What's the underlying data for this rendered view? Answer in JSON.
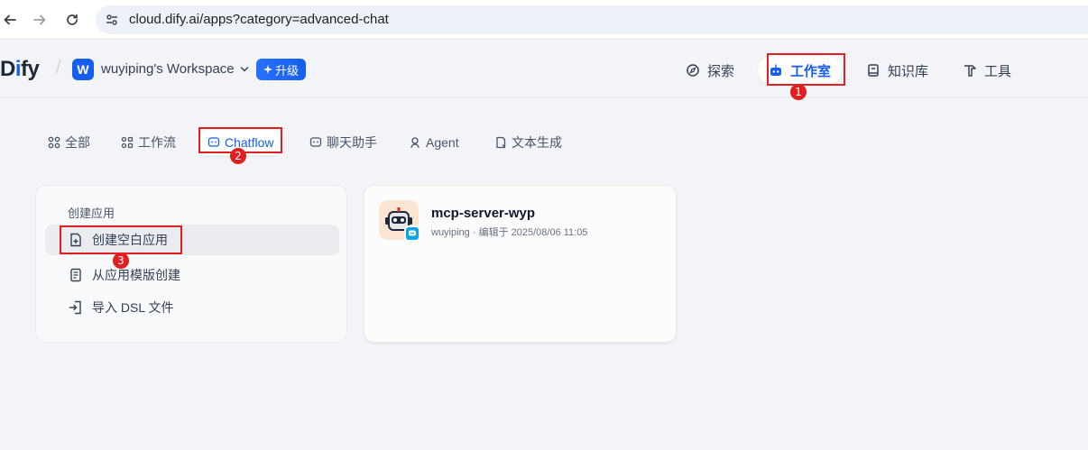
{
  "browser": {
    "url": "cloud.dify.ai/apps?category=advanced-chat"
  },
  "header": {
    "logo_prefix": "D",
    "logo_i": "i",
    "logo_suffix": "fy",
    "workspace_initial": "W",
    "workspace_name": "wuyiping's Workspace",
    "upgrade_label": "升级",
    "nav": [
      {
        "label": "探索",
        "icon": "compass-icon"
      },
      {
        "label": "工作室",
        "icon": "robot-icon"
      },
      {
        "label": "知识库",
        "icon": "book-icon"
      },
      {
        "label": "工具",
        "icon": "hammer-icon"
      }
    ]
  },
  "categories": [
    {
      "label": "全部",
      "icon": "grid-icon"
    },
    {
      "label": "工作流",
      "icon": "workflow-icon"
    },
    {
      "label": "Chatflow",
      "icon": "chat-bubble-icon"
    },
    {
      "label": "聊天助手",
      "icon": "chat-bot-icon"
    },
    {
      "label": "Agent",
      "icon": "agent-icon"
    },
    {
      "label": "文本生成",
      "icon": "file-text-icon"
    }
  ],
  "create": {
    "title": "创建应用",
    "items": [
      {
        "label": "创建空白应用",
        "icon": "file-plus-icon"
      },
      {
        "label": "从应用模版创建",
        "icon": "template-icon"
      },
      {
        "label": "导入 DSL 文件",
        "icon": "import-icon"
      }
    ]
  },
  "app_card": {
    "name": "mcp-server-wyp",
    "meta": "wuyiping · 编辑于 2025/08/06 11:05"
  },
  "markers": [
    "1",
    "2",
    "3"
  ],
  "colors": {
    "accent": "#155eef",
    "highlight": "#e02020",
    "badge": "#0ba5ec"
  }
}
